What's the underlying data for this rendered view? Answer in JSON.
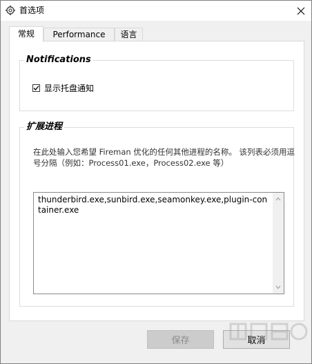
{
  "window": {
    "title": "首选项"
  },
  "tabs": [
    {
      "label": "常规",
      "active": true
    },
    {
      "label": "Performance",
      "active": false
    },
    {
      "label": "语言",
      "active": false
    }
  ],
  "notifications": {
    "title": "Notifications",
    "checkbox_label": "显示托盘通知",
    "checked": true
  },
  "extend": {
    "title": "扩展进程",
    "description": "在此处输入您希望 Fireman 优化的任何其他进程的名称。 该列表必须用逗号分隔（例如：Process01.exe，Process02.exe 等）",
    "value": "thunderbird.exe,sunbird.exe,seamonkey.exe,plugin-container.exe"
  },
  "buttons": {
    "save": "保存",
    "cancel": "取消"
  },
  "icons": {
    "app": "gear-icon",
    "close": "close-icon",
    "check": "check-icon",
    "scroll_up": "chevron-up-icon",
    "scroll_down": "chevron-down-icon"
  }
}
